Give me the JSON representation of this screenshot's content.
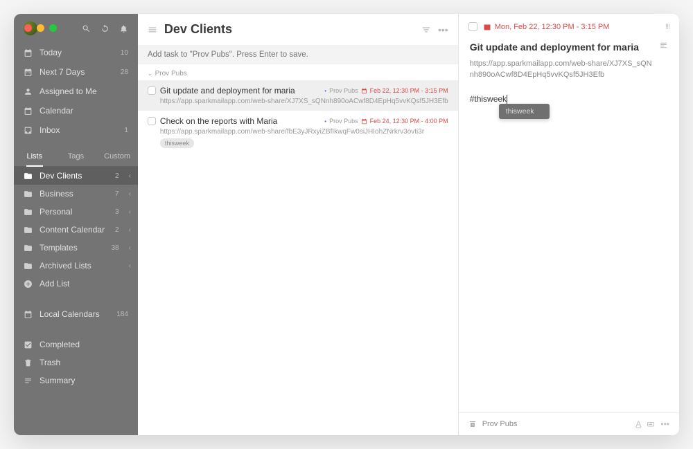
{
  "sidebar": {
    "nav": [
      {
        "icon": "calendar-today",
        "label": "Today",
        "count": "10"
      },
      {
        "icon": "calendar-7",
        "label": "Next 7 Days",
        "count": "28"
      },
      {
        "icon": "user",
        "label": "Assigned to Me",
        "count": ""
      },
      {
        "icon": "calendar",
        "label": "Calendar",
        "count": ""
      },
      {
        "icon": "inbox",
        "label": "Inbox",
        "count": "1"
      }
    ],
    "tabs": {
      "lists": "Lists",
      "tags": "Tags",
      "custom": "Custom"
    },
    "lists": [
      {
        "label": "Dev Clients",
        "count": "2"
      },
      {
        "label": "Business",
        "count": "7"
      },
      {
        "label": "Personal",
        "count": "3"
      },
      {
        "label": "Content Calendar",
        "count": "2"
      },
      {
        "label": "Templates",
        "count": "38"
      },
      {
        "label": "Archived Lists",
        "count": ""
      }
    ],
    "add_list": "Add List",
    "local_cal": {
      "label": "Local Calendars",
      "count": "184"
    },
    "footer": [
      {
        "label": "Completed"
      },
      {
        "label": "Trash"
      },
      {
        "label": "Summary"
      }
    ]
  },
  "middle": {
    "title": "Dev Clients",
    "add_placeholder": "Add task to \"Prov Pubs\". Press Enter to save.",
    "group": "Prov Pubs",
    "tasks": [
      {
        "title": "Git update and deployment for maria",
        "list": "Prov Pubs",
        "date": "Feb 22, 12:30 PM - 3:15 PM",
        "url": "https://app.sparkmailapp.com/web-share/XJ7XS_sQNnh890oACwf8D4EpHq5vvKQsf5JH3Efb"
      },
      {
        "title": "Check on the reports with Maria",
        "list": "Prov Pubs",
        "date": "Feb 24, 12:30 PM - 4:00 PM",
        "url": "https://app.sparkmailapp.com/web-share/fbE3yJRxyiZBfIkwqFw0siJHIohZNrkrv3ovti3r",
        "tag": "thisweek"
      }
    ]
  },
  "detail": {
    "date": "Mon, Feb 22, 12:30 PM - 3:15 PM",
    "title": "Git update and deployment for maria",
    "url": "https://app.sparkmailapp.com/web-share/XJ7XS_sQNnh890oACwf8D4EpHq5vvKQsf5JH3Efb",
    "note": "#thisweek",
    "suggestion": "thisweek",
    "footer_list": "Prov Pubs"
  }
}
